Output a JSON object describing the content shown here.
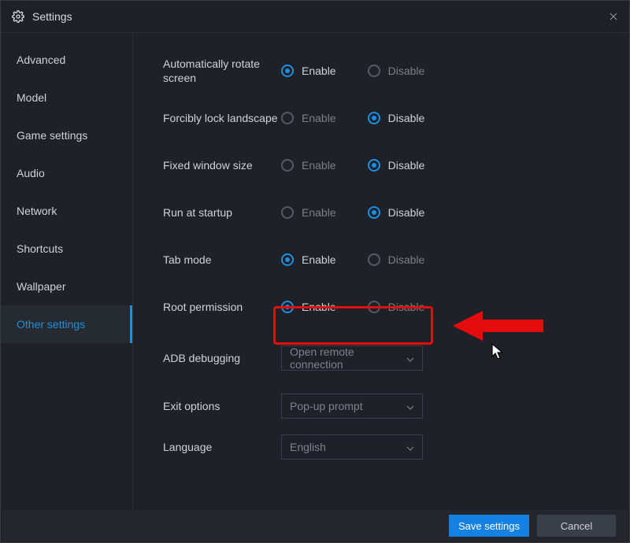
{
  "window": {
    "title": "Settings"
  },
  "sidebar": {
    "items": [
      {
        "label": "Advanced"
      },
      {
        "label": "Model"
      },
      {
        "label": "Game settings"
      },
      {
        "label": "Audio"
      },
      {
        "label": "Network"
      },
      {
        "label": "Shortcuts"
      },
      {
        "label": "Wallpaper"
      },
      {
        "label": "Other settings"
      }
    ],
    "active_index": 7
  },
  "options": {
    "rotate": {
      "label": "Automatically rotate screen",
      "enable": "Enable",
      "disable": "Disable",
      "value": "enable"
    },
    "lock": {
      "label": "Forcibly lock landscape",
      "enable": "Enable",
      "disable": "Disable",
      "value": "disable"
    },
    "fixed": {
      "label": "Fixed window size",
      "enable": "Enable",
      "disable": "Disable",
      "value": "disable"
    },
    "startup": {
      "label": "Run at startup",
      "enable": "Enable",
      "disable": "Disable",
      "value": "disable"
    },
    "tab": {
      "label": "Tab mode",
      "enable": "Enable",
      "disable": "Disable",
      "value": "enable"
    },
    "root": {
      "label": "Root permission",
      "enable": "Enable",
      "disable": "Disable",
      "value": "enable"
    },
    "adb": {
      "label": "ADB debugging",
      "selected": "Open remote connection"
    },
    "exit": {
      "label": "Exit options",
      "selected": "Pop-up prompt"
    },
    "lang": {
      "label": "Language",
      "selected": "English"
    }
  },
  "footer": {
    "save": "Save settings",
    "cancel": "Cancel"
  }
}
